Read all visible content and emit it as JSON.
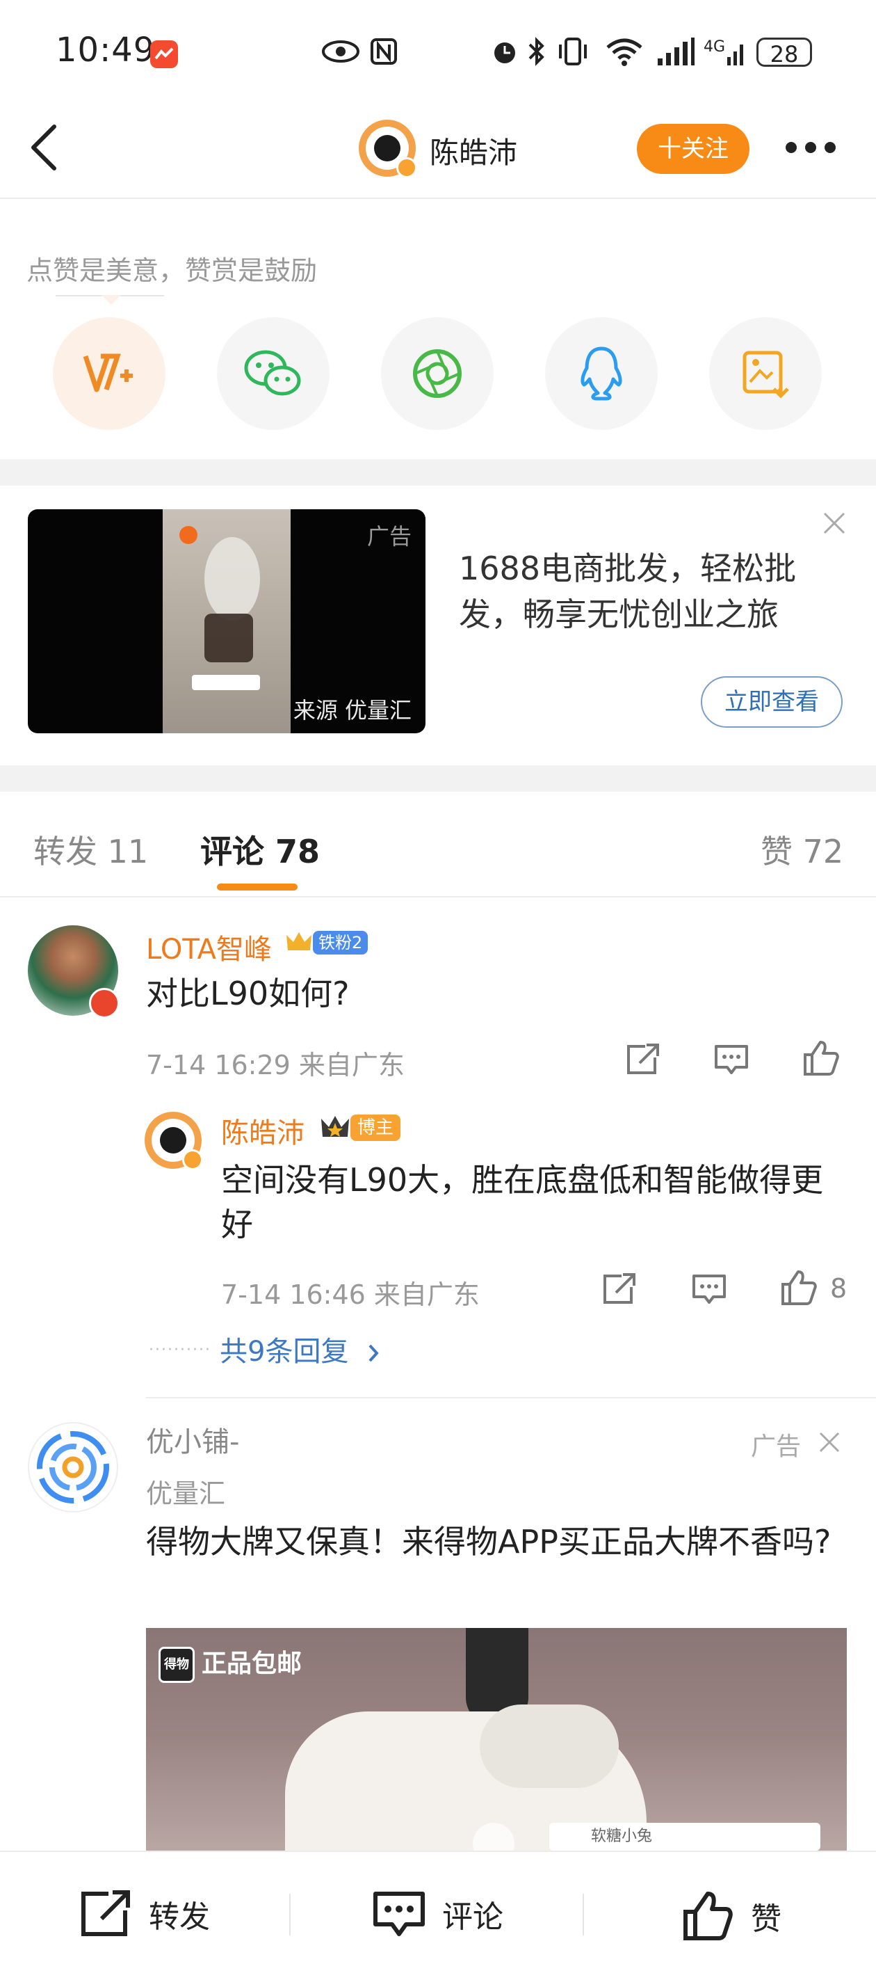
{
  "status_bar": {
    "time": "10:49",
    "battery": "28"
  },
  "header": {
    "username": "陈皓沛",
    "follow_label": "十关注"
  },
  "reward": {
    "title": "点赞是美意，赞赏是鼓励"
  },
  "ad": {
    "label": "广告",
    "source": "来源 优量汇",
    "text": "1688电商批发，轻松批发，畅享无忧创业之旅",
    "cta": "立即查看"
  },
  "tabs": {
    "repost": "转发 11",
    "comment": "评论 78",
    "like": "赞 72"
  },
  "comments": [
    {
      "username": "LOTA智峰",
      "badge": "铁粉2",
      "text": "对比L90如何?",
      "time": "7-14 16:29  来自广东",
      "reply": {
        "username": "陈皓沛",
        "badge": "博主",
        "text": "空间没有L90大，胜在底盘低和智能做得更好",
        "time": "7-14 16:46  来自广东",
        "likes": "8"
      },
      "more_replies": "共9条回复"
    }
  ],
  "ad_comment": {
    "username": "优小铺-",
    "source": "优量汇",
    "tag": "广告",
    "text": "得物大牌又保真！来得物APP买正品大牌不香吗?",
    "image_label": "正品包邮",
    "image_logo": "得物",
    "image_user": "软糖小兔"
  },
  "bottom_bar": {
    "repost": "转发",
    "comment": "评论",
    "like": "赞"
  },
  "colors": {
    "accent": "#f88a16",
    "link": "#3d78c2",
    "username": "#ee7a1c"
  }
}
